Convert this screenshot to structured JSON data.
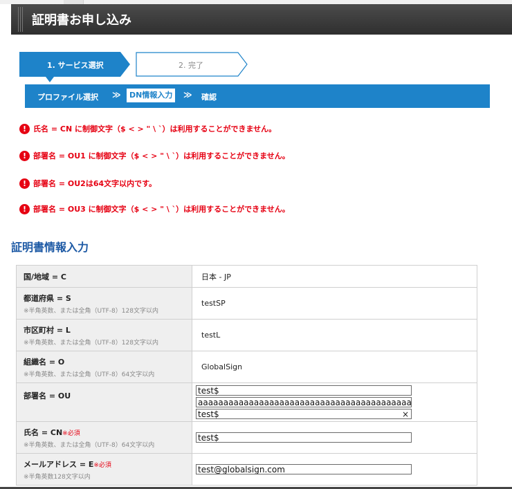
{
  "header": {
    "title": "証明書お申し込み"
  },
  "steps": [
    {
      "label": "1. サービス選択"
    },
    {
      "label": "2. 完了"
    }
  ],
  "subnav": {
    "profile": "プロファイル選択",
    "dn": "DN情報入力",
    "confirm": "確認",
    "arrow": "≫"
  },
  "errors": [
    {
      "icon": "!",
      "text": "氏名 = CN に制御文字（$ < > \" \\ `）は利用することができません。"
    },
    {
      "icon": "!",
      "text": "部署名 = OU1 に制御文字（$ < > \" \\ `）は利用することができません。"
    },
    {
      "icon": "!",
      "text": "部署名 = OU2は64文字以内です。"
    },
    {
      "icon": "!",
      "text": "部署名 = OU3 に制御文字（$ < > \" \\ `）は利用することができません。"
    }
  ],
  "section_title": "証明書情報入力",
  "form": {
    "country": {
      "label": "国/地域 = C",
      "value": "日本 - JP"
    },
    "state": {
      "label": "都道府県 = S",
      "note": "※半角英数、または全角（UTF-8）128文字以内",
      "value": "testSP"
    },
    "city": {
      "label": "市区町村 = L",
      "note": "※半角英数、または全角（UTF-8）128文字以内",
      "value": "testL"
    },
    "org": {
      "label": "組織名 = O",
      "note": "※半角英数、または全角（UTF-8）64文字以内",
      "value": "GlobalSign"
    },
    "ou": {
      "label": "部署名 = OU",
      "values": [
        "test$",
        "aaaaaaaaaaaaaaaaaaaaaaaaaaaaaaaaaaaaaaaaaaaaaaaaa",
        "test$"
      ],
      "clear": "×"
    },
    "cn": {
      "label": "氏名 = CN",
      "required": "※必須",
      "note": "※半角英数、または全角（UTF-8）64文字以内",
      "value": "test$"
    },
    "email": {
      "label": "メールアドレス = E",
      "required": "※必須",
      "note": "※半角英数128文字以内",
      "value": "test@globalsign.com"
    }
  }
}
